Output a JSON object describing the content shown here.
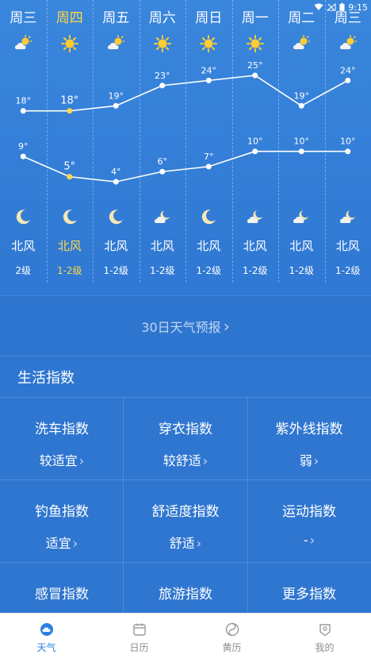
{
  "status": {
    "time": "9:15"
  },
  "days": [
    {
      "name": "周三",
      "high": "18°",
      "low": "9°",
      "high_v": 18,
      "low_v": 9,
      "wind": "北风",
      "level": "2级",
      "day_icon": "partly-cloudy-icon",
      "night_icon": "moon-icon"
    },
    {
      "name": "周四",
      "high": "18°",
      "low": "5°",
      "high_v": 18,
      "low_v": 5,
      "wind": "北风",
      "level": "1-2级",
      "day_icon": "sun-icon",
      "night_icon": "moon-icon",
      "selected": true
    },
    {
      "name": "周五",
      "high": "19°",
      "low": "4°",
      "high_v": 19,
      "low_v": 4,
      "wind": "北风",
      "level": "1-2级",
      "day_icon": "partly-cloudy-icon",
      "night_icon": "moon-icon"
    },
    {
      "name": "周六",
      "high": "23°",
      "low": "6°",
      "high_v": 23,
      "low_v": 6,
      "wind": "北风",
      "level": "1-2级",
      "day_icon": "sun-icon",
      "night_icon": "cloudy-night-icon"
    },
    {
      "name": "周日",
      "high": "24°",
      "low": "7°",
      "high_v": 24,
      "low_v": 7,
      "wind": "北风",
      "level": "1-2级",
      "day_icon": "sun-icon",
      "night_icon": "moon-icon"
    },
    {
      "name": "周一",
      "high": "25°",
      "low": "10°",
      "high_v": 25,
      "low_v": 10,
      "wind": "北风",
      "level": "1-2级",
      "day_icon": "sun-icon",
      "night_icon": "cloudy-night-icon"
    },
    {
      "name": "周二",
      "high": "19°",
      "low": "10°",
      "high_v": 19,
      "low_v": 10,
      "wind": "北风",
      "level": "1-2级",
      "day_icon": "partly-cloudy-icon",
      "night_icon": "cloudy-night-icon"
    },
    {
      "name": "周三",
      "high": "24°",
      "low": "10°",
      "high_v": 24,
      "low_v": 10,
      "wind": "北风",
      "level": "1-2级",
      "day_icon": "partly-cloudy-icon",
      "night_icon": "cloudy-night-icon"
    }
  ],
  "forecast30": {
    "label": "30日天气预报",
    "chevron": "›"
  },
  "life": {
    "title": "生活指数",
    "items": [
      {
        "name": "洗车指数",
        "value": "较适宜"
      },
      {
        "name": "穿衣指数",
        "value": "较舒适"
      },
      {
        "name": "紫外线指数",
        "value": "弱"
      },
      {
        "name": "钓鱼指数",
        "value": "适宜"
      },
      {
        "name": "舒适度指数",
        "value": "舒适"
      },
      {
        "name": "运动指数",
        "value": "-"
      },
      {
        "name": "感冒指数",
        "value": ""
      },
      {
        "name": "旅游指数",
        "value": ""
      },
      {
        "name": "更多指数",
        "value": ""
      }
    ]
  },
  "tabs": [
    {
      "label": "天气",
      "icon": "weather-icon",
      "active": true
    },
    {
      "label": "日历",
      "icon": "calendar-icon"
    },
    {
      "label": "黄历",
      "icon": "almanac-icon"
    },
    {
      "label": "我的",
      "icon": "profile-icon"
    }
  ],
  "colors": {
    "accent": "#2f80e0",
    "selected": "#ffd84a",
    "background": "#2f76d0"
  }
}
